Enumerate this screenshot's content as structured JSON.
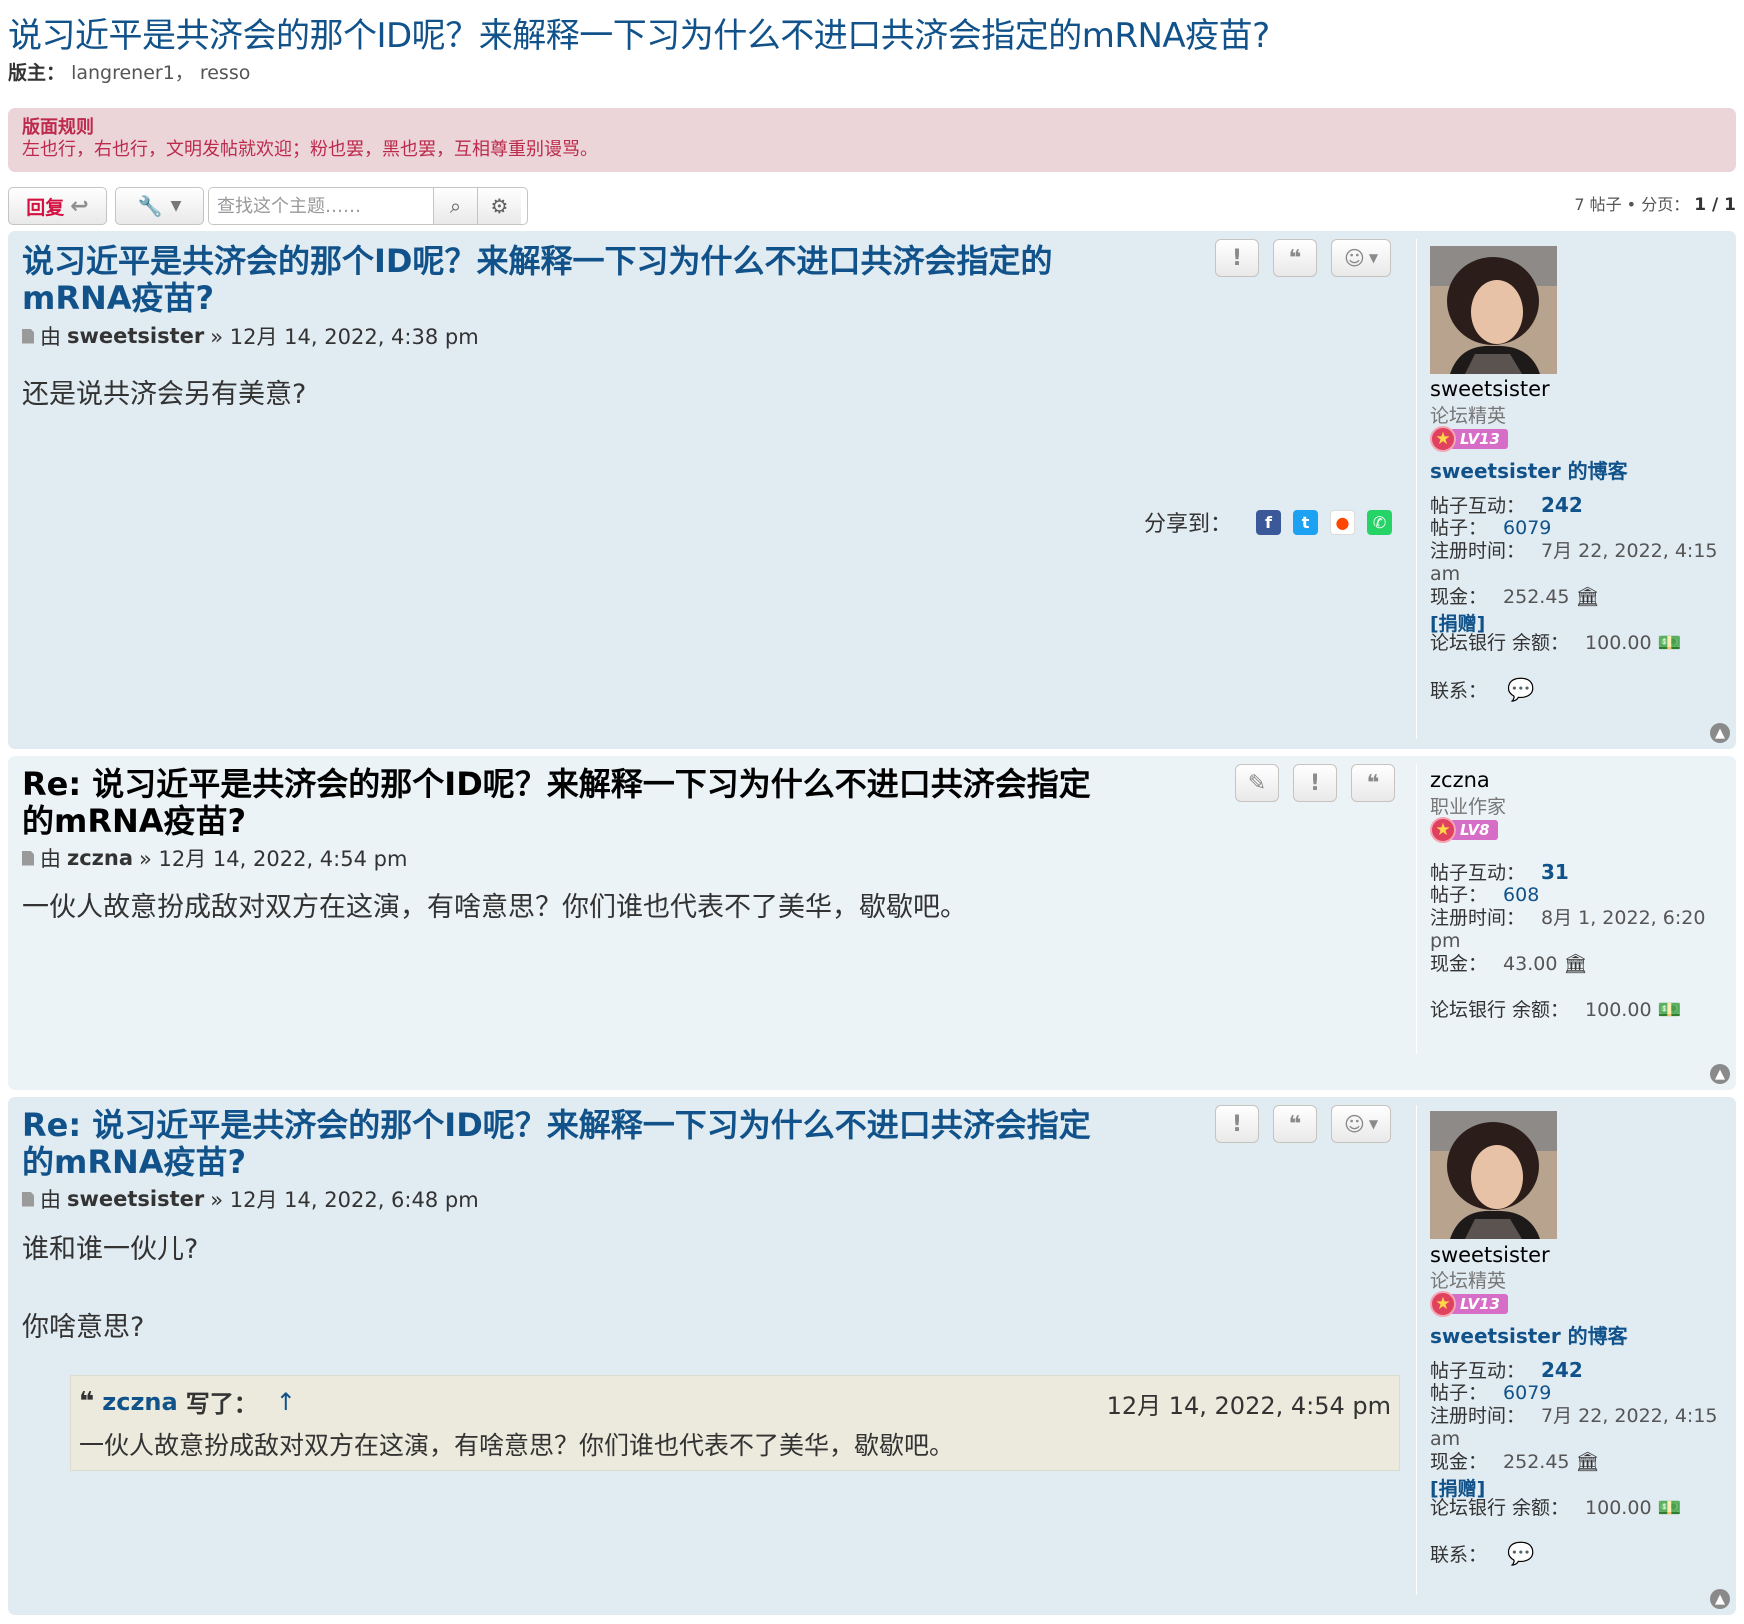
{
  "topic_title": "说习近平是共济会的那个ID呢？来解释一下习为什么不进口共济会指定的mRNA疫苗?",
  "moderators": {
    "label": "版主：",
    "names": "langrener1， resso"
  },
  "rules": {
    "title": "版面规则",
    "body": "左也行，右也行，文明发帖就欢迎；粉也罢，黑也罢，互相尊重别谩骂。"
  },
  "action_bar": {
    "reply_label": "回复",
    "search_placeholder": "查找这个主题……",
    "pagination": {
      "count": "7 帖子 • 分页：",
      "pages": "1 / 1"
    }
  },
  "posts": [
    {
      "title": "说习近平是共济会的那个ID呢？来解释一下习为什么不进口共济会指定的mRNA疫苗?",
      "by": "由",
      "author": "sweetsister",
      "date": "» 12月 14, 2022, 4:38 pm",
      "content": [
        "还是说共济会另有美意?"
      ],
      "share_label": "分享到：",
      "profile": {
        "username": "sweetsister",
        "rank": "论坛精英",
        "level": "LV13",
        "blog": "sweetsister 的博客",
        "interactions_label": "帖子互动：",
        "interactions": "242",
        "posts_label": "帖子：",
        "posts": "6079",
        "joined_label": "注册时间：",
        "joined": "7月 22, 2022, 4:15 am",
        "cash_label": "现金：",
        "cash": "252.45",
        "donate": "[捐赠]",
        "bank_label": "论坛银行 余额：",
        "bank": "100.00",
        "contact_label": "联系："
      }
    },
    {
      "title": "Re: 说习近平是共济会的那个ID呢？来解释一下习为什么不进口共济会指定的mRNA疫苗?",
      "by": "由",
      "author": "zczna",
      "date": "» 12月 14, 2022, 4:54 pm",
      "content": [
        "一伙人故意扮成敌对双方在这演，有啥意思？你们谁也代表不了美华，歇歇吧。"
      ],
      "profile": {
        "username": "zczna",
        "rank": "职业作家",
        "level": "LV8",
        "interactions_label": "帖子互动：",
        "interactions": "31",
        "posts_label": "帖子：",
        "posts": "608",
        "joined_label": "注册时间：",
        "joined": "8月 1, 2022, 6:20 pm",
        "cash_label": "现金：",
        "cash": "43.00",
        "bank_label": "论坛银行 余额：",
        "bank": "100.00"
      }
    },
    {
      "title": "Re: 说习近平是共济会的那个ID呢？来解释一下习为什么不进口共济会指定的mRNA疫苗?",
      "by": "由",
      "author": "sweetsister",
      "date": "» 12月 14, 2022, 6:48 pm",
      "content": [
        "谁和谁一伙儿?",
        "你啥意思?"
      ],
      "quote": {
        "author": "zczna",
        "wrote": "写了：",
        "arrow": "↑",
        "date": "12月 14, 2022, 4:54 pm",
        "text": "一伙人故意扮成敌对双方在这演，有啥意思？你们谁也代表不了美华，歇歇吧。"
      },
      "profile": {
        "username": "sweetsister",
        "rank": "论坛精英",
        "level": "LV13",
        "blog": "sweetsister 的博客",
        "interactions_label": "帖子互动：",
        "interactions": "242",
        "posts_label": "帖子：",
        "posts": "6079",
        "joined_label": "注册时间：",
        "joined": "7月 22, 2022, 4:15 am",
        "cash_label": "现金：",
        "cash": "252.45",
        "donate": "[捐赠]",
        "bank_label": "论坛银行 余额：",
        "bank": "100.00",
        "contact_label": "联系："
      }
    }
  ],
  "icons": {
    "reply": "reply-icon",
    "tools": "wrench-icon",
    "search": "search-icon",
    "settings": "gear-icon",
    "report": "exclamation-icon",
    "quote": "quote-icon",
    "react": "smiley-icon",
    "edit": "pencil-icon",
    "bank": "bank-icon",
    "money": "banknote-icon",
    "contact": "chat-icon",
    "top": "back-to-top-icon"
  },
  "colors": {
    "link": "#105289",
    "post_bg": "#E1EBF2",
    "post_bg_alt": "#ECF3F7",
    "rules_bg": "#ECD5D8",
    "rules_text": "#BC2A4D",
    "reply_text": "#D31141",
    "quote_bg": "#EBEADD"
  }
}
